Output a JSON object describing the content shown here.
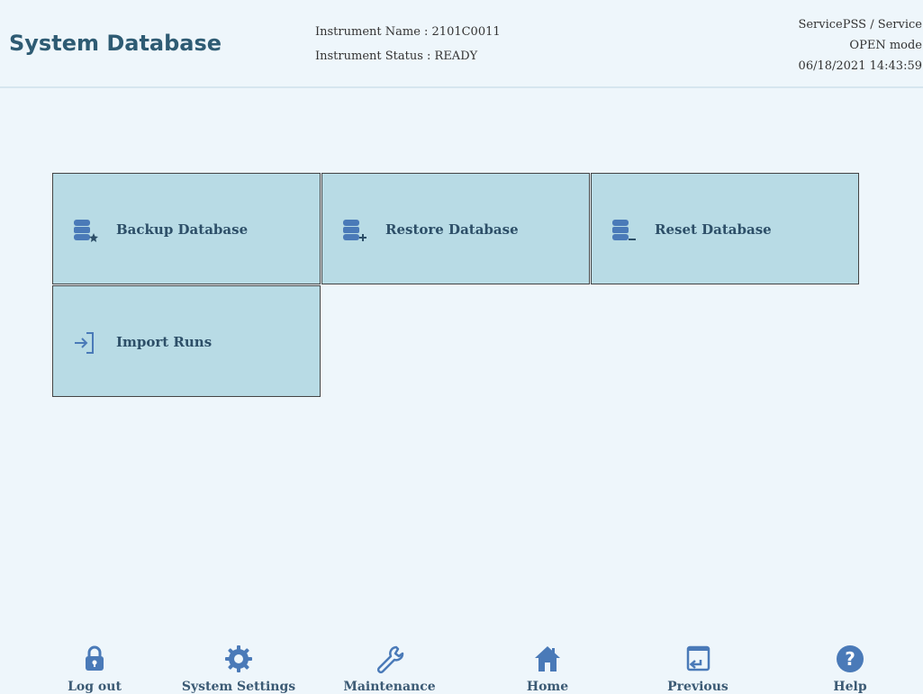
{
  "header": {
    "title": "System Database",
    "instrument_name": "Instrument Name : 2101C0011",
    "instrument_status": "Instrument Status : READY",
    "user": "ServicePSS / Service",
    "mode": "OPEN mode",
    "datetime": "06/18/2021 14:43:59"
  },
  "tiles": [
    {
      "label": "Backup Database",
      "icon": "database-star-icon"
    },
    {
      "label": "Restore Database",
      "icon": "database-plus-icon"
    },
    {
      "label": "Reset Database",
      "icon": "database-minus-icon"
    },
    {
      "label": "Import Runs",
      "icon": "import-icon"
    }
  ],
  "footer": {
    "items": [
      {
        "label": "Log out",
        "icon": "lock-icon"
      },
      {
        "label": "System Settings",
        "icon": "gear-icon"
      },
      {
        "label": "Maintenance",
        "icon": "wrench-icon"
      },
      {
        "label": "Home",
        "icon": "home-icon"
      },
      {
        "label": "Previous",
        "icon": "previous-icon"
      },
      {
        "label": "Help",
        "icon": "help-icon"
      }
    ]
  },
  "colors": {
    "background": "#eef6fb",
    "tile": "#b8dbe5",
    "title": "#2e5b73",
    "icon": "#4a7ab8"
  }
}
